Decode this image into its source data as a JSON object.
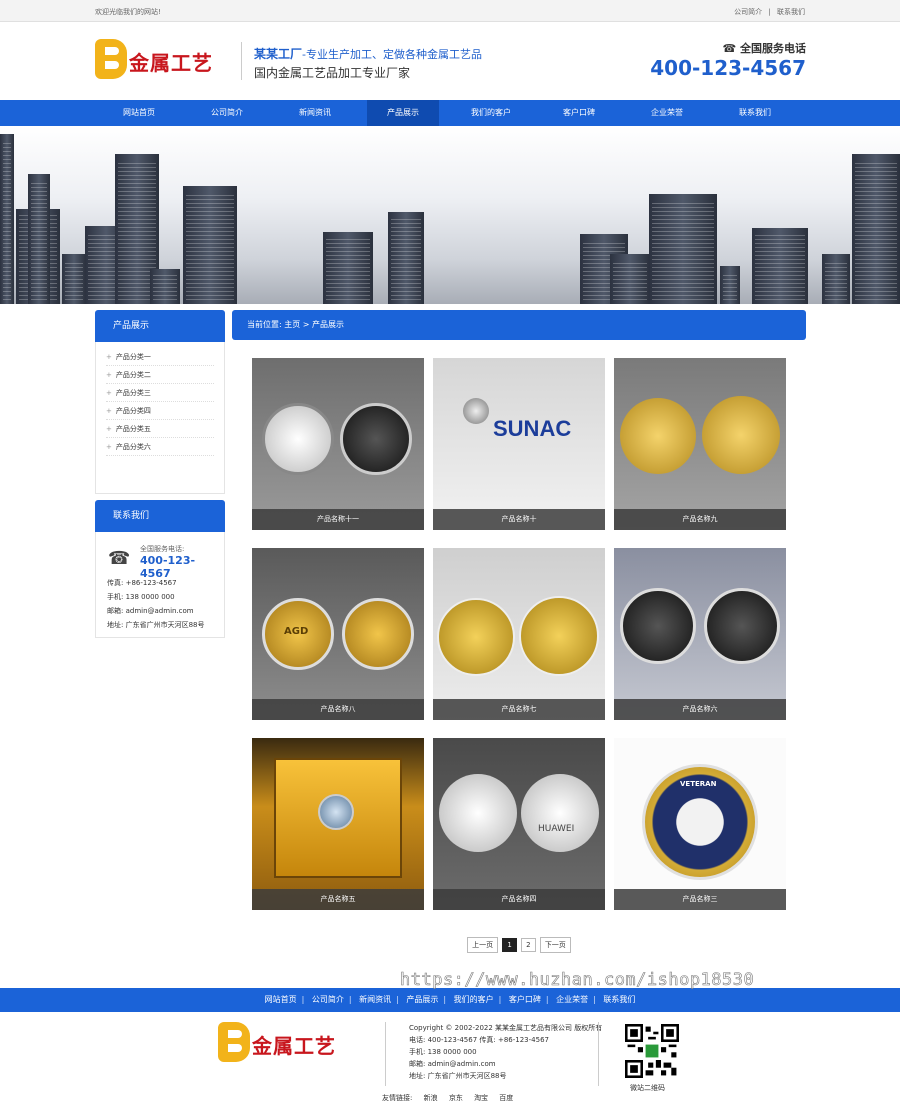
{
  "topbar": {
    "welcome": "欢迎光临我们的网站!",
    "links": [
      "公司简介",
      "|",
      "联系我们"
    ]
  },
  "header": {
    "logo_text": "金属工艺",
    "slogan_main": "某某工厂",
    "slogan_sub": "-专业生产加工、定做各种金属工艺品",
    "slogan_line2": "国内金属工艺品加工专业厂家",
    "hotline_label": "全国服务电话",
    "hotline_number": "400-123-4567"
  },
  "nav": {
    "items": [
      "网站首页",
      "公司简介",
      "新闻资讯",
      "产品展示",
      "我们的客户",
      "客户口碑",
      "企业荣誉",
      "联系我们"
    ],
    "active": "产品展示"
  },
  "sidebar": {
    "products_title": "产品展示",
    "categories": [
      "产品分类一",
      "产品分类二",
      "产品分类三",
      "产品分类四",
      "产品分类五",
      "产品分类六"
    ],
    "contact_title": "联系我们",
    "contact_label": "全国服务电话:",
    "contact_tel": "400-123-4567",
    "fax": "传真: +86-123-4567",
    "mobile": "手机: 138 0000 000",
    "email": "邮箱: admin@admin.com",
    "address": "地址: 广东省广州市天河区88号"
  },
  "main": {
    "breadcrumb": "当前位置: 主页 > 产品展示",
    "products": [
      "产品名称十一",
      "产品名称十",
      "产品名称九",
      "产品名称八",
      "产品名称七",
      "产品名称六",
      "产品名称五",
      "产品名称四",
      "产品名称三"
    ],
    "coin_text": [
      "SUNAC",
      "AGD",
      "HUAWEI",
      "VETERAN"
    ],
    "pager": {
      "prev": "上一页",
      "pages": [
        "1",
        "2"
      ],
      "current": "1",
      "next": "下一页"
    }
  },
  "footer": {
    "nav": [
      "网站首页",
      "公司简介",
      "新闻资讯",
      "产品展示",
      "我们的客户",
      "客户口碑",
      "企业荣誉",
      "联系我们"
    ],
    "logo_text": "金属工艺",
    "copyright": "Copyright © 2002-2022 某某金属工艺品有限公司 版权所有",
    "phone_fax": "电话: 400-123-4567 传真: +86-123-4567",
    "mobile": "手机: 138 0000 000",
    "email": "邮箱: admin@admin.com",
    "address": "地址: 广东省广州市天河区88号",
    "qr_label": "微站二维码",
    "friend_label": "友情链接:",
    "friend_links": [
      "新浪",
      "京东",
      "淘宝",
      "百度"
    ]
  },
  "watermark": "https://www.huzhan.com/ishop18530",
  "colors": {
    "brand_blue": "#1b63d8",
    "accent_gold": "#f2b31a",
    "logo_red": "#c8161d"
  }
}
